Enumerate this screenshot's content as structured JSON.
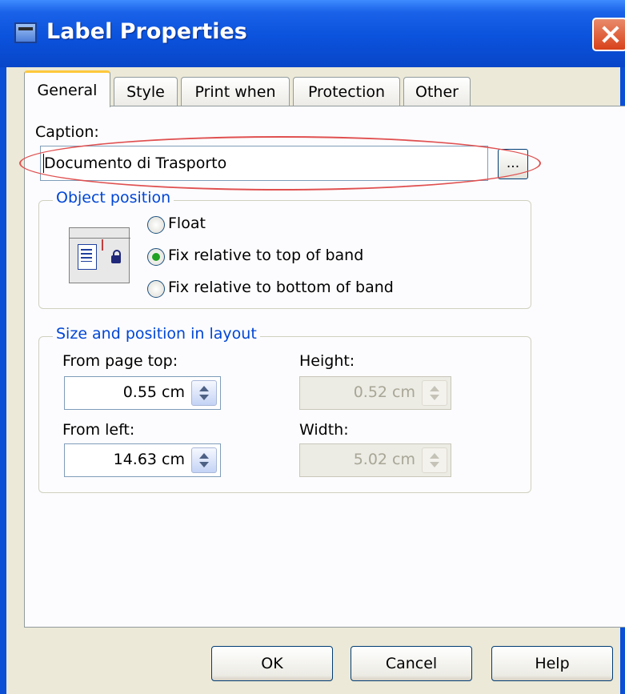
{
  "window": {
    "title": "Label Properties"
  },
  "tabs": [
    {
      "label": "General"
    },
    {
      "label": "Style"
    },
    {
      "label": "Print when"
    },
    {
      "label": "Protection"
    },
    {
      "label": "Other"
    }
  ],
  "caption": {
    "label": "Caption:",
    "value": "Documento di Trasporto",
    "ellipsis": "..."
  },
  "object_position": {
    "title": "Object position",
    "options": [
      {
        "label": "Float",
        "checked": false
      },
      {
        "label": "Fix relative to top of band",
        "checked": true
      },
      {
        "label": "Fix relative to bottom of band",
        "checked": false
      }
    ]
  },
  "layout": {
    "title": "Size and position in layout",
    "from_top_label": "From page top:",
    "from_top_value": "0.55 cm",
    "height_label": "Height:",
    "height_value": "0.52 cm",
    "from_left_label": "From left:",
    "from_left_value": "14.63 cm",
    "width_label": "Width:",
    "width_value": "5.02 cm"
  },
  "buttons": {
    "ok": "OK",
    "cancel": "Cancel",
    "help": "Help"
  },
  "colors": {
    "titlebar": "#0b52dc",
    "group_title": "#0046d5",
    "highlight": "#e05050"
  }
}
